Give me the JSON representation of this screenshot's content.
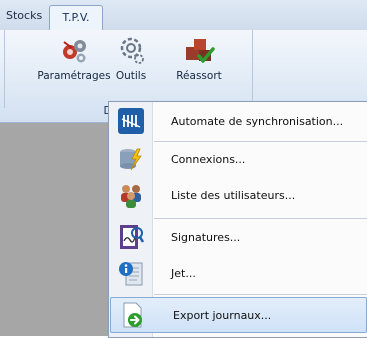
{
  "tabs": [
    "Stocks",
    "T.P.V."
  ],
  "ribbon": {
    "buttons": [
      {
        "label": "Paramétrages",
        "icon": "settings-gears-icon"
      },
      {
        "label": "Outils",
        "icon": "tools-icon"
      },
      {
        "label": "Réassort",
        "icon": "restock-boxes-icon"
      }
    ],
    "group_label": "Divers"
  },
  "menu": {
    "items": [
      {
        "label": "Automate de synchronisation...",
        "icon": "sync-automaton-icon"
      },
      {
        "label": "Connexions...",
        "icon": "connections-database-icon"
      },
      {
        "label": "Liste des utilisateurs...",
        "icon": "users-list-icon"
      },
      {
        "label": "Signatures...",
        "icon": "signatures-icon"
      },
      {
        "label": "Jet...",
        "icon": "jet-info-icon"
      },
      {
        "label": "Export journaux...",
        "icon": "export-journals-icon"
      }
    ],
    "highlighted_item": "Export journaux..."
  },
  "colors": {
    "workspace": "#a6a6a6",
    "ribbon_text": "#15325d",
    "highlight_border": "#87a9d3"
  }
}
